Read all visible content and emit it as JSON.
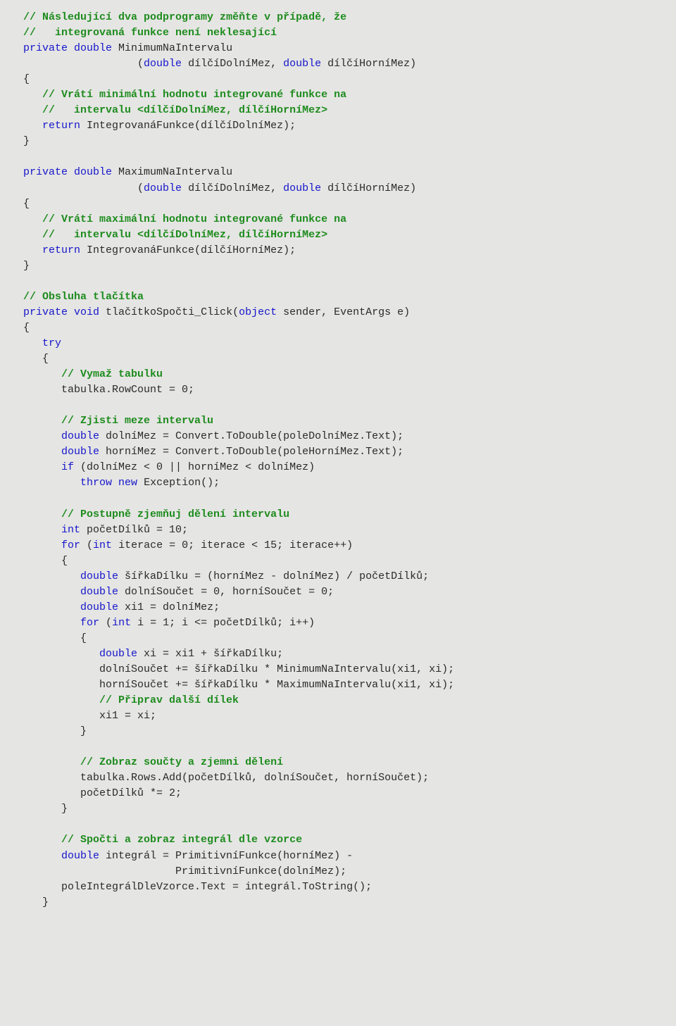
{
  "code": {
    "lines": [
      {
        "b": 3,
        "class": "c-comment",
        "text": "// Následující dva podprogramy změňte v případě, že"
      },
      {
        "b": 3,
        "class": "c-comment",
        "text": "//   integrovaná funkce není neklesající"
      },
      {
        "b": 3,
        "segments": [
          [
            "c-keyword",
            "private "
          ],
          [
            "c-type",
            "double "
          ],
          [
            "c-text",
            "MinimumNaIntervalu"
          ]
        ]
      },
      {
        "b": 21,
        "segments": [
          [
            "c-text",
            "("
          ],
          [
            "c-type",
            "double "
          ],
          [
            "c-text",
            "dílčíDolníMez, "
          ],
          [
            "c-type",
            "double "
          ],
          [
            "c-text",
            "dílčíHorníMez)"
          ]
        ]
      },
      {
        "b": 3,
        "class": "c-text",
        "text": "{"
      },
      {
        "b": 6,
        "class": "c-comment",
        "text": "// Vrátí minimální hodnotu integrované funkce na"
      },
      {
        "b": 6,
        "class": "c-comment",
        "text": "//   intervalu <dílčíDolníMez, dílčíHorníMez>"
      },
      {
        "b": 6,
        "segments": [
          [
            "c-keyword",
            "return "
          ],
          [
            "c-text",
            "IntegrovanáFunkce(dílčíDolníMez);"
          ]
        ]
      },
      {
        "b": 3,
        "class": "c-text",
        "text": "}"
      },
      {
        "b": 0,
        "blank": true
      },
      {
        "b": 3,
        "segments": [
          [
            "c-keyword",
            "private "
          ],
          [
            "c-type",
            "double "
          ],
          [
            "c-text",
            "MaximumNaIntervalu"
          ]
        ]
      },
      {
        "b": 21,
        "segments": [
          [
            "c-text",
            "("
          ],
          [
            "c-type",
            "double "
          ],
          [
            "c-text",
            "dílčíDolníMez, "
          ],
          [
            "c-type",
            "double "
          ],
          [
            "c-text",
            "dílčíHorníMez)"
          ]
        ]
      },
      {
        "b": 3,
        "class": "c-text",
        "text": "{"
      },
      {
        "b": 6,
        "class": "c-comment",
        "text": "// Vrátí maximální hodnotu integrované funkce na"
      },
      {
        "b": 6,
        "class": "c-comment",
        "text": "//   intervalu <dílčíDolníMez, dílčíHorníMez>"
      },
      {
        "b": 6,
        "segments": [
          [
            "c-keyword",
            "return "
          ],
          [
            "c-text",
            "IntegrovanáFunkce(dílčíHorníMez);"
          ]
        ]
      },
      {
        "b": 3,
        "class": "c-text",
        "text": "}"
      },
      {
        "b": 0,
        "blank": true
      },
      {
        "b": 3,
        "class": "c-comment",
        "text": "// Obsluha tlačítka"
      },
      {
        "b": 3,
        "segments": [
          [
            "c-keyword",
            "private "
          ],
          [
            "c-keyword",
            "void "
          ],
          [
            "c-text",
            "tlačítkoSpočti_Click("
          ],
          [
            "c-keyword",
            "object "
          ],
          [
            "c-text",
            "sender, EventArgs e)"
          ]
        ]
      },
      {
        "b": 3,
        "class": "c-text",
        "text": "{"
      },
      {
        "b": 6,
        "class": "c-keyword",
        "text": "try"
      },
      {
        "b": 6,
        "class": "c-text",
        "text": "{"
      },
      {
        "b": 9,
        "class": "c-comment",
        "text": "// Vymaž tabulku"
      },
      {
        "b": 9,
        "class": "c-text",
        "text": "tabulka.RowCount = 0;"
      },
      {
        "b": 0,
        "blank": true
      },
      {
        "b": 9,
        "class": "c-comment",
        "text": "// Zjisti meze intervalu"
      },
      {
        "b": 9,
        "segments": [
          [
            "c-type",
            "double "
          ],
          [
            "c-text",
            "dolníMez = Convert.ToDouble(poleDolníMez.Text);"
          ]
        ]
      },
      {
        "b": 9,
        "segments": [
          [
            "c-type",
            "double "
          ],
          [
            "c-text",
            "horníMez = Convert.ToDouble(poleHorníMez.Text);"
          ]
        ]
      },
      {
        "b": 9,
        "segments": [
          [
            "c-keyword",
            "if "
          ],
          [
            "c-text",
            "(dolníMez < 0 || horníMez < dolníMez)"
          ]
        ]
      },
      {
        "b": 12,
        "segments": [
          [
            "c-keyword",
            "throw "
          ],
          [
            "c-new",
            "new "
          ],
          [
            "c-text",
            "Exception();"
          ]
        ]
      },
      {
        "b": 0,
        "blank": true
      },
      {
        "b": 9,
        "class": "c-comment",
        "text": "// Postupně zjemňuj dělení intervalu"
      },
      {
        "b": 9,
        "segments": [
          [
            "c-type",
            "int "
          ],
          [
            "c-text",
            "početDílků = 10;"
          ]
        ]
      },
      {
        "b": 9,
        "segments": [
          [
            "c-keyword",
            "for "
          ],
          [
            "c-text",
            "("
          ],
          [
            "c-type",
            "int "
          ],
          [
            "c-text",
            "iterace = 0; iterace < 15; iterace++)"
          ]
        ]
      },
      {
        "b": 9,
        "class": "c-text",
        "text": "{"
      },
      {
        "b": 12,
        "segments": [
          [
            "c-type",
            "double "
          ],
          [
            "c-text",
            "šířkaDílku = (horníMez - dolníMez) / početDílků;"
          ]
        ]
      },
      {
        "b": 12,
        "segments": [
          [
            "c-type",
            "double "
          ],
          [
            "c-text",
            "dolníSoučet = 0, horníSoučet = 0;"
          ]
        ]
      },
      {
        "b": 12,
        "segments": [
          [
            "c-type",
            "double "
          ],
          [
            "c-text",
            "xi1 = dolníMez;"
          ]
        ]
      },
      {
        "b": 12,
        "segments": [
          [
            "c-keyword",
            "for "
          ],
          [
            "c-text",
            "("
          ],
          [
            "c-type",
            "int "
          ],
          [
            "c-text",
            "i = 1; i <= početDílků; i++)"
          ]
        ]
      },
      {
        "b": 12,
        "class": "c-text",
        "text": "{"
      },
      {
        "b": 15,
        "segments": [
          [
            "c-type",
            "double "
          ],
          [
            "c-text",
            "xi = xi1 + šířkaDílku;"
          ]
        ]
      },
      {
        "b": 15,
        "class": "c-text",
        "text": "dolníSoučet += šířkaDílku * MinimumNaIntervalu(xi1, xi);"
      },
      {
        "b": 15,
        "class": "c-text",
        "text": "horníSoučet += šířkaDílku * MaximumNaIntervalu(xi1, xi);"
      },
      {
        "b": 15,
        "class": "c-comment",
        "text": "// Připrav další dílek"
      },
      {
        "b": 15,
        "class": "c-text",
        "text": "xi1 = xi;"
      },
      {
        "b": 12,
        "class": "c-text",
        "text": "}"
      },
      {
        "b": 0,
        "blank": true
      },
      {
        "b": 12,
        "class": "c-comment",
        "text": "// Zobraz součty a zjemni dělení"
      },
      {
        "b": 12,
        "class": "c-text",
        "text": "tabulka.Rows.Add(početDílků, dolníSoučet, horníSoučet);"
      },
      {
        "b": 12,
        "class": "c-text",
        "text": "početDílků *= 2;"
      },
      {
        "b": 9,
        "class": "c-text",
        "text": "}"
      },
      {
        "b": 0,
        "blank": true
      },
      {
        "b": 9,
        "class": "c-comment",
        "text": "// Spočti a zobraz integrál dle vzorce"
      },
      {
        "b": 9,
        "segments": [
          [
            "c-type",
            "double "
          ],
          [
            "c-text",
            "integrál = PrimitivníFunkce(horníMez) -"
          ]
        ]
      },
      {
        "b": 27,
        "class": "c-text",
        "text": "PrimitivníFunkce(dolníMez);"
      },
      {
        "b": 9,
        "class": "c-text",
        "text": "poleIntegrálDleVzorce.Text = integrál.ToString();"
      },
      {
        "b": 6,
        "class": "c-text",
        "text": "}"
      }
    ]
  }
}
